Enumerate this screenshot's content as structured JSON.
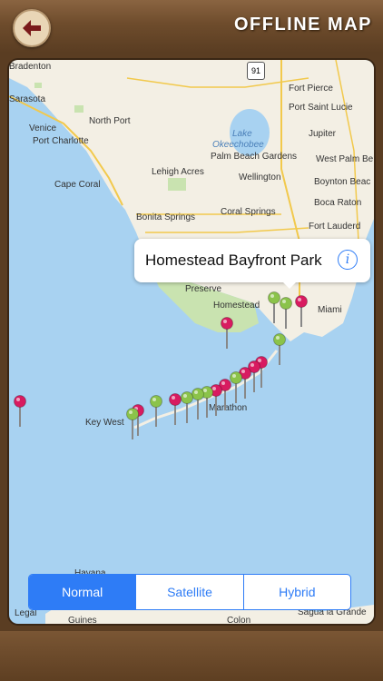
{
  "header": {
    "title": "OFFLINE MAP",
    "back_label": "back"
  },
  "map": {
    "labels": [
      {
        "text": "Bradenton"
      },
      {
        "text": "Sarasota"
      },
      {
        "text": "North Port"
      },
      {
        "text": "Venice"
      },
      {
        "text": "Port Charlotte"
      },
      {
        "text": "Cape Coral"
      },
      {
        "text": "Lehigh Acres"
      },
      {
        "text": "Bonita Springs"
      },
      {
        "text": "Coral Springs"
      },
      {
        "text": "Fort Pierce"
      },
      {
        "text": "Port Saint Lucie"
      },
      {
        "text": "Jupiter"
      },
      {
        "text": "Lake"
      },
      {
        "text": "Okeechobee"
      },
      {
        "text": "Palm Beach Gardens"
      },
      {
        "text": "West Palm Be"
      },
      {
        "text": "Wellington"
      },
      {
        "text": "Boynton Beac"
      },
      {
        "text": "Boca Raton"
      },
      {
        "text": "Fort Lauderd"
      },
      {
        "text": "Miami"
      },
      {
        "text": "Preserve"
      },
      {
        "text": "Homestead"
      },
      {
        "text": "Key West"
      },
      {
        "text": "Marathon"
      },
      {
        "text": "Havana"
      },
      {
        "text": "Legal"
      },
      {
        "text": "Guines"
      },
      {
        "text": "Colon"
      },
      {
        "text": "Sagua la Grande"
      }
    ],
    "highway_shield": "91",
    "callout": {
      "title": "Homestead Bayfront Park",
      "info_icon": "i"
    }
  },
  "segmented": {
    "options": [
      "Normal",
      "Satellite",
      "Hybrid"
    ],
    "selected": "Normal"
  },
  "colors": {
    "accent": "#2e7cf6",
    "pin_red": "#d81b60",
    "pin_green": "#8bc34a",
    "water": "#a8d2f1",
    "land": "#f3efe4",
    "park": "#c9e3b0",
    "wood": "#6e4c2c"
  }
}
